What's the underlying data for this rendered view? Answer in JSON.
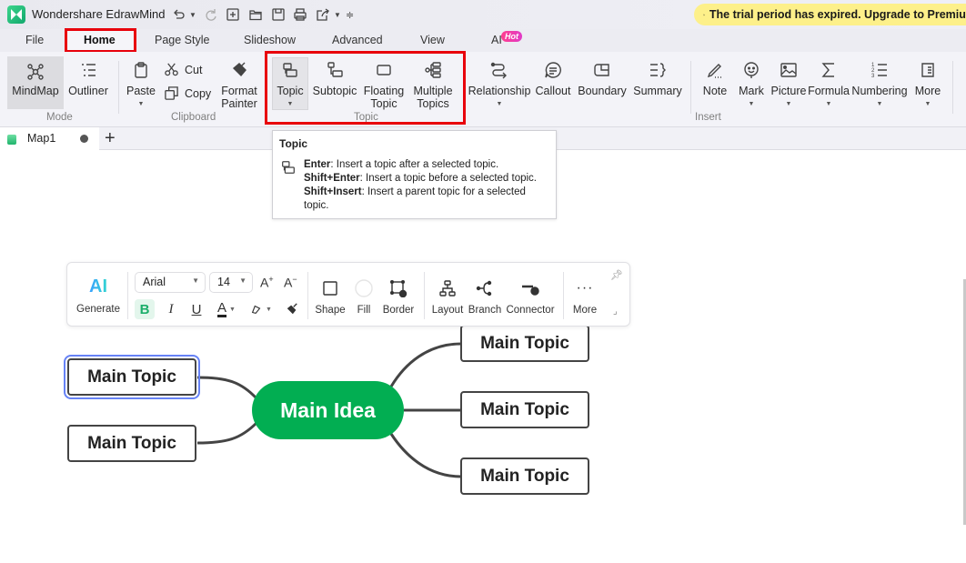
{
  "app": {
    "title": "Wondershare EdrawMind",
    "trial_banner": "The trial period has expired. Upgrade to Premium"
  },
  "quick_access": [
    "undo-icon",
    "redo-icon",
    "new-icon",
    "open-icon",
    "save-icon",
    "print-icon",
    "export-icon",
    "customize-icon"
  ],
  "menu_tabs": [
    {
      "label": "File"
    },
    {
      "label": "Home",
      "active": true
    },
    {
      "label": "Page Style"
    },
    {
      "label": "Slideshow"
    },
    {
      "label": "Advanced"
    },
    {
      "label": "View"
    },
    {
      "label": "AI",
      "badge": "Hot"
    }
  ],
  "ribbon": {
    "mode": {
      "label": "Mode",
      "mindmap": "MindMap",
      "outliner": "Outliner"
    },
    "clipboard": {
      "label": "Clipboard",
      "paste": "Paste",
      "cut": "Cut",
      "copy": "Copy",
      "format_painter_1": "Format",
      "format_painter_2": "Painter"
    },
    "topic": {
      "label": "Topic",
      "topic": "Topic",
      "subtopic": "Subtopic",
      "floating_1": "Floating",
      "floating_2": "Topic",
      "multiple_1": "Multiple",
      "multiple_2": "Topics"
    },
    "insert": {
      "label": "Insert",
      "relationship": "Relationship",
      "callout": "Callout",
      "boundary": "Boundary",
      "summary": "Summary",
      "note": "Note",
      "mark": "Mark",
      "picture": "Picture",
      "formula": "Formula",
      "numbering": "Numbering",
      "more": "More"
    }
  },
  "doc_tabs": [
    {
      "name": "Map1",
      "unsaved": true
    }
  ],
  "tooltip": {
    "title": "Topic",
    "lines": [
      {
        "key": "Enter",
        "text": ": Insert a topic after a selected topic."
      },
      {
        "key": "Shift+Enter",
        "text": ": Insert a topic before a selected topic."
      },
      {
        "key": "Shift+Insert",
        "text": ": Insert a parent topic for a selected topic."
      }
    ]
  },
  "floating_toolbar": {
    "ai_logo": "AI",
    "generate": "Generate",
    "font": "Arial",
    "size": "14",
    "increase": "A",
    "decrease": "A",
    "bold": "B",
    "italic": "I",
    "underline": "U",
    "font_color": "A",
    "shape": "Shape",
    "fill": "Fill",
    "border": "Border",
    "layout": "Layout",
    "branch": "Branch",
    "connector": "Connector",
    "more": "More"
  },
  "mindmap": {
    "central": "Main Idea",
    "left": [
      "Main Topic",
      "Main Topic"
    ],
    "right": [
      "Main Topic",
      "Main Topic",
      "Main Topic"
    ],
    "selected": "left-0"
  },
  "colors": {
    "accent_green": "#02ae52",
    "highlight_red": "#e8000b",
    "selection_blue": "#6682f5",
    "trial_yellow": "#fdf08a"
  }
}
